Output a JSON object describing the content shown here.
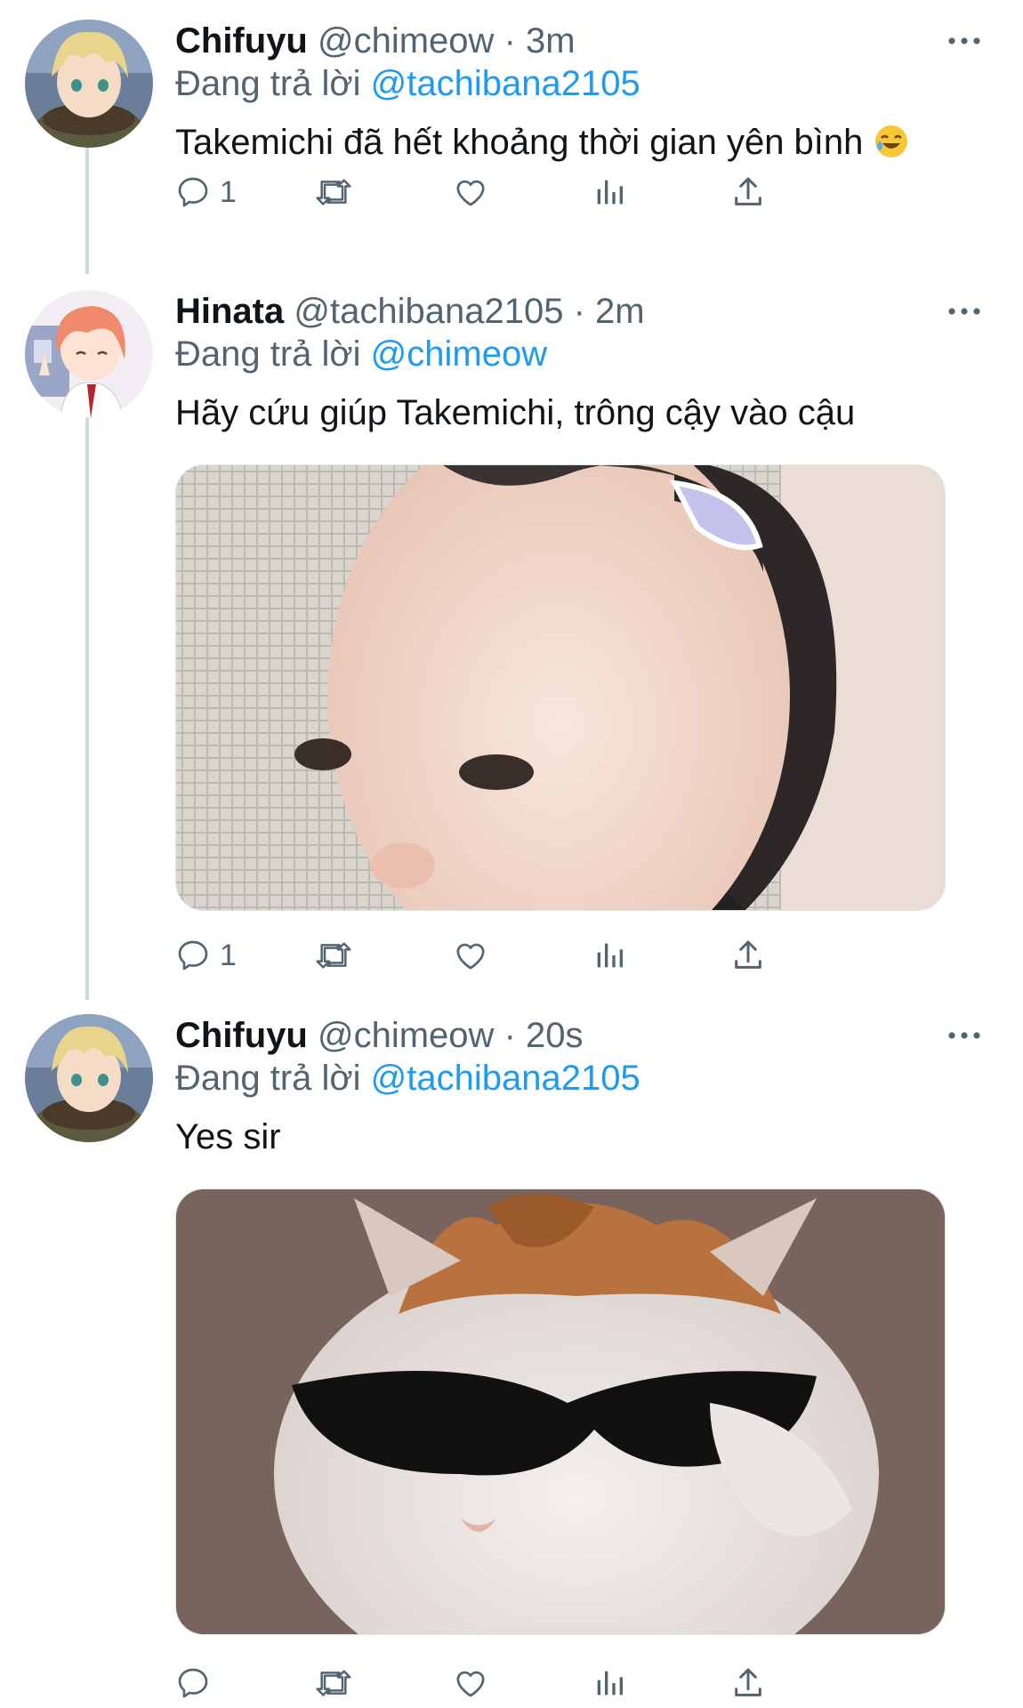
{
  "tweets": [
    {
      "name": "Chifuyu",
      "handle": "@chimeow",
      "separator": "·",
      "time": "3m",
      "replying_prefix": "Đang trả lời",
      "replying_to": "@tachibana2105",
      "text": "Takemichi đã hết khoảng thời gian yên bình",
      "emoji": "rolling-on-floor-laughing",
      "avatar": "chifuyu-avatar",
      "reply_count": "1"
    },
    {
      "name": "Hinata",
      "handle": "@tachibana2105",
      "separator": "·",
      "time": "2m",
      "replying_prefix": "Đang trả lời",
      "replying_to": "@chimeow",
      "text": "Hãy cứu giúp Takemichi, trông cậy vào cậu",
      "avatar": "hinata-avatar",
      "media": "baby-photo",
      "reply_count": "1"
    },
    {
      "name": "Chifuyu",
      "handle": "@chimeow",
      "separator": "·",
      "time": "20s",
      "replying_prefix": "Đang trả lời",
      "replying_to": "@tachibana2105",
      "text": "Yes sir",
      "avatar": "chifuyu-avatar",
      "media": "cat-sunglasses-photo",
      "reply_count": ""
    }
  ],
  "icons": [
    "reply-icon",
    "retweet-icon",
    "like-icon",
    "analytics-icon",
    "share-icon",
    "more-icon"
  ],
  "colors": {
    "text": "#0f1419",
    "secondary": "#536471",
    "link": "#1d9bf0",
    "thread_line": "#cfd9de"
  }
}
